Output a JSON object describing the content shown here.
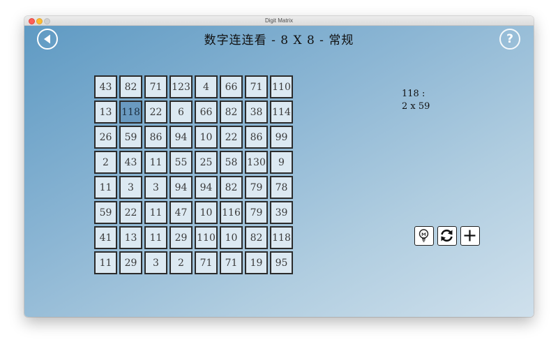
{
  "window": {
    "title": "Digit Matrix"
  },
  "header": {
    "title": "数字连连看 - 8 X 8 - 常规",
    "back_icon": "back-arrow-icon",
    "help_icon": "help-icon",
    "help_glyph": "?"
  },
  "grid": {
    "rows": [
      [
        "43",
        "82",
        "71",
        "123",
        "4",
        "66",
        "71",
        "110"
      ],
      [
        "13",
        "118",
        "22",
        "6",
        "66",
        "82",
        "38",
        "114"
      ],
      [
        "26",
        "59",
        "86",
        "94",
        "10",
        "22",
        "86",
        "99"
      ],
      [
        "2",
        "43",
        "11",
        "55",
        "25",
        "58",
        "130",
        "9"
      ],
      [
        "11",
        "3",
        "3",
        "94",
        "94",
        "82",
        "79",
        "78"
      ],
      [
        "59",
        "22",
        "11",
        "47",
        "10",
        "116",
        "79",
        "39"
      ],
      [
        "41",
        "13",
        "11",
        "29",
        "110",
        "10",
        "82",
        "118"
      ],
      [
        "11",
        "29",
        "3",
        "2",
        "71",
        "71",
        "19",
        "95"
      ]
    ],
    "selected": {
      "row": 1,
      "col": 1
    }
  },
  "info": {
    "number_line": "118 :",
    "factors_line": "2 x 59"
  },
  "toolbar": {
    "hint_icon": "lightbulb-icon",
    "refresh_icon": "refresh-icon",
    "add_icon": "plus-icon"
  },
  "colors": {
    "cell_background": "#dce9f2",
    "cell_selected": "#6a9ac0",
    "cell_border": "#2b2b2b",
    "background_top": "#5f9ac3",
    "background_bottom": "#cfe0ec"
  }
}
